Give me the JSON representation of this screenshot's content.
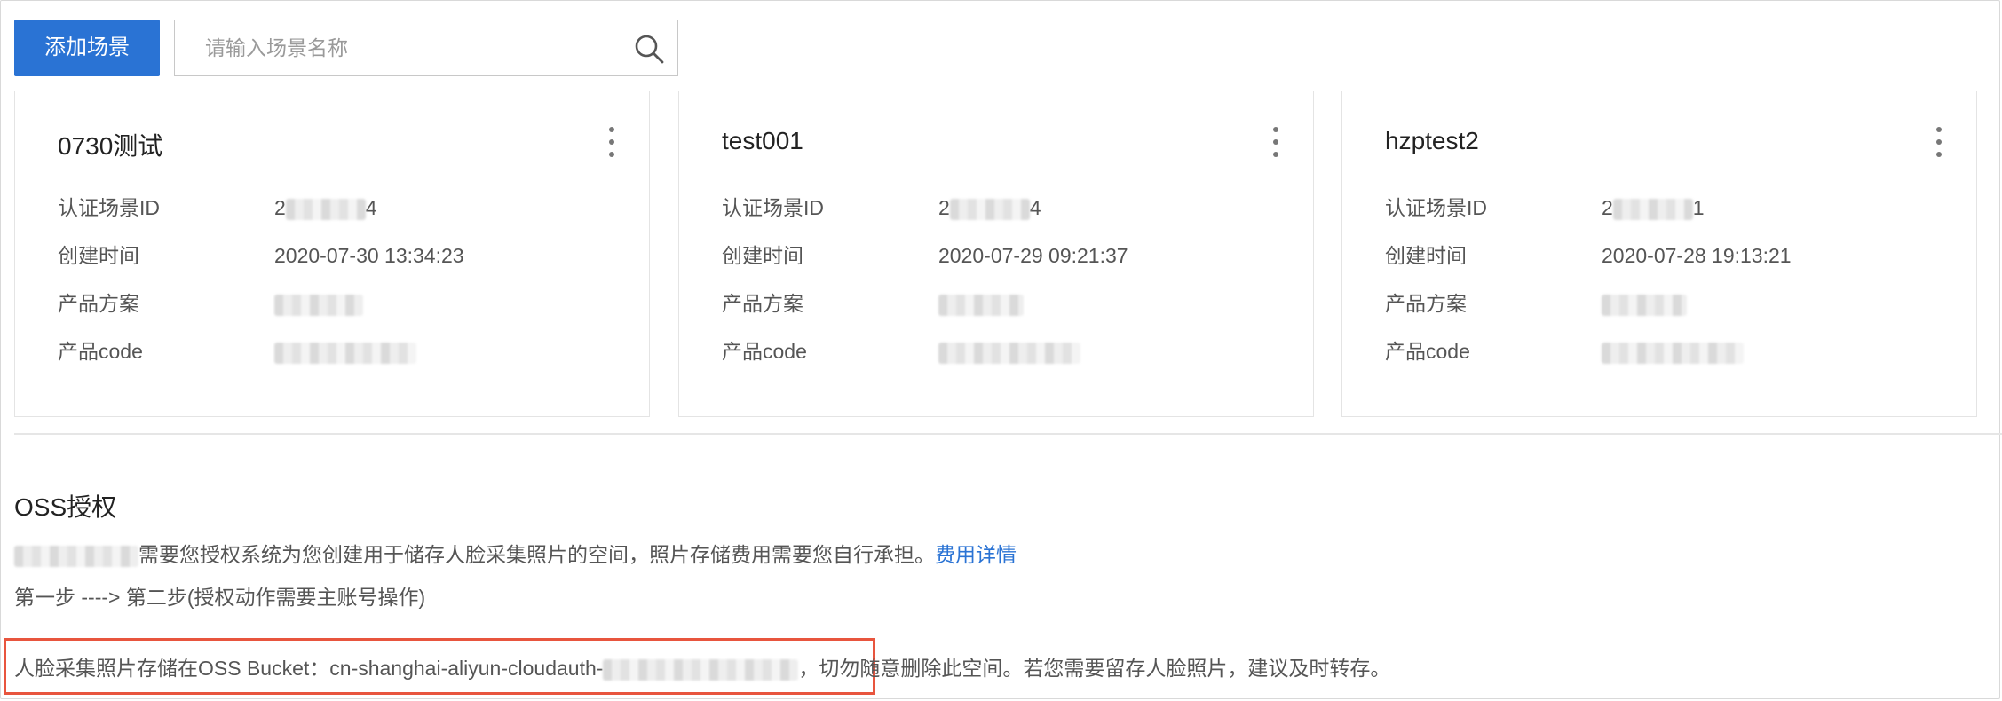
{
  "toolbar": {
    "add_scene_label": "添加场景",
    "search_placeholder": "请输入场景名称",
    "search_icon": "search-icon"
  },
  "cards": [
    {
      "title": "0730测试",
      "rows": [
        {
          "label": "认证场景ID",
          "value_prefix": "2",
          "value_suffix": "4"
        },
        {
          "label": "创建时间",
          "value": "2020-07-30 13:34:23"
        },
        {
          "label": "产品方案"
        },
        {
          "label": "产品code"
        }
      ]
    },
    {
      "title": "test001",
      "rows": [
        {
          "label": "认证场景ID",
          "value_prefix": "2",
          "value_suffix": "4"
        },
        {
          "label": "创建时间",
          "value": "2020-07-29 09:21:37"
        },
        {
          "label": "产品方案"
        },
        {
          "label": "产品code"
        }
      ]
    },
    {
      "title": "hzptest2",
      "rows": [
        {
          "label": "认证场景ID",
          "value_prefix": "2",
          "value_suffix": "1"
        },
        {
          "label": "创建时间",
          "value": "2020-07-28 19:13:21"
        },
        {
          "label": "产品方案"
        },
        {
          "label": "产品code"
        }
      ]
    }
  ],
  "oss": {
    "title": "OSS授权",
    "desc_text": "需要您授权系统为您创建用于储存人脸采集照片的空间，照片存储费用需要您自行承担。",
    "fee_link": "费用详情",
    "steps": "第一步 ----> 第二步(授权动作需要主账号操作)",
    "bucket_prefix": "人脸采集照片存储在OSS Bucket：cn-shanghai-aliyun-cloudauth-",
    "bucket_suffix": "，切勿随意删除此空间。若您需要留存人脸照片，建议及时转存。"
  },
  "colors": {
    "primary": "#2a73d4",
    "highlight": "#e8553e"
  }
}
